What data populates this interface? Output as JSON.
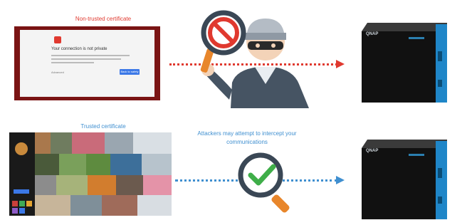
{
  "labels": {
    "non_trusted": "Non-trusted certificate",
    "trusted": "Trusted certificate",
    "attack_note": "Attackers may attempt to intercept your communications"
  },
  "browser_error": {
    "title": "Your connection is not private",
    "link": "Advanced",
    "button": "Back to safety"
  },
  "device": {
    "brand": "QNAP"
  },
  "colors": {
    "danger": "#e0392f",
    "safe": "#3f8fd0",
    "check_green": "#3fae49",
    "magnifier_orange": "#e8862b",
    "nas_blue": "#1f86c8"
  },
  "icons": {
    "attacker": "hacker-with-mask-icon",
    "blocked": "prohibited-magnifier-icon",
    "verified": "checkmark-magnifier-icon",
    "storage": "nas-device-icon"
  }
}
